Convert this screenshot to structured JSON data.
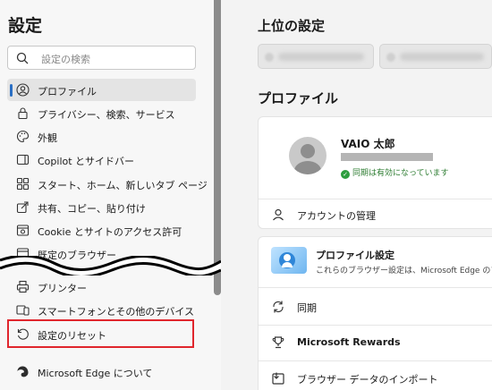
{
  "sidebar": {
    "title": "設定",
    "search_placeholder": "設定の検索",
    "items": [
      {
        "label": "プロファイル",
        "icon": "profile-icon"
      },
      {
        "label": "プライバシー、検索、サービス",
        "icon": "lock-icon"
      },
      {
        "label": "外観",
        "icon": "palette-icon"
      },
      {
        "label": "Copilot とサイドバー",
        "icon": "sidebar-icon"
      },
      {
        "label": "スタート、ホーム、新しいタブ ページ",
        "icon": "home-icon"
      },
      {
        "label": "共有、コピー、貼り付け",
        "icon": "share-icon"
      },
      {
        "label": "Cookie とサイトのアクセス許可",
        "icon": "cookie-icon"
      },
      {
        "label": "既定のブラウザー",
        "icon": "browser-icon"
      },
      {
        "label": "プリンター",
        "icon": "printer-icon"
      },
      {
        "label": "スマートフォンとその他のデバイス",
        "icon": "phone-icon"
      },
      {
        "label": "設定のリセット",
        "icon": "reset-icon"
      },
      {
        "label": "Microsoft Edge について",
        "icon": "edge-icon"
      }
    ]
  },
  "main": {
    "top_settings_title": "上位の設定",
    "profile_section_title": "プロファイル",
    "user_name": "VAIO 太郎",
    "sync_status": "同期は有効になっています",
    "manage_account": "アカウントの管理",
    "profile_settings_title": "プロファイル設定",
    "profile_settings_desc": "これらのブラウザー設定は、Microsoft Edge のプロ",
    "rows": [
      {
        "label": "同期",
        "icon": "sync-icon"
      },
      {
        "label": "Microsoft Rewards",
        "icon": "trophy-icon"
      },
      {
        "label": "ブラウザー データのインポート",
        "icon": "import-icon"
      }
    ]
  },
  "colors": {
    "accent": "#2a6fc4",
    "highlight_box": "#e0262d",
    "sync_green": "#2e7d32"
  }
}
